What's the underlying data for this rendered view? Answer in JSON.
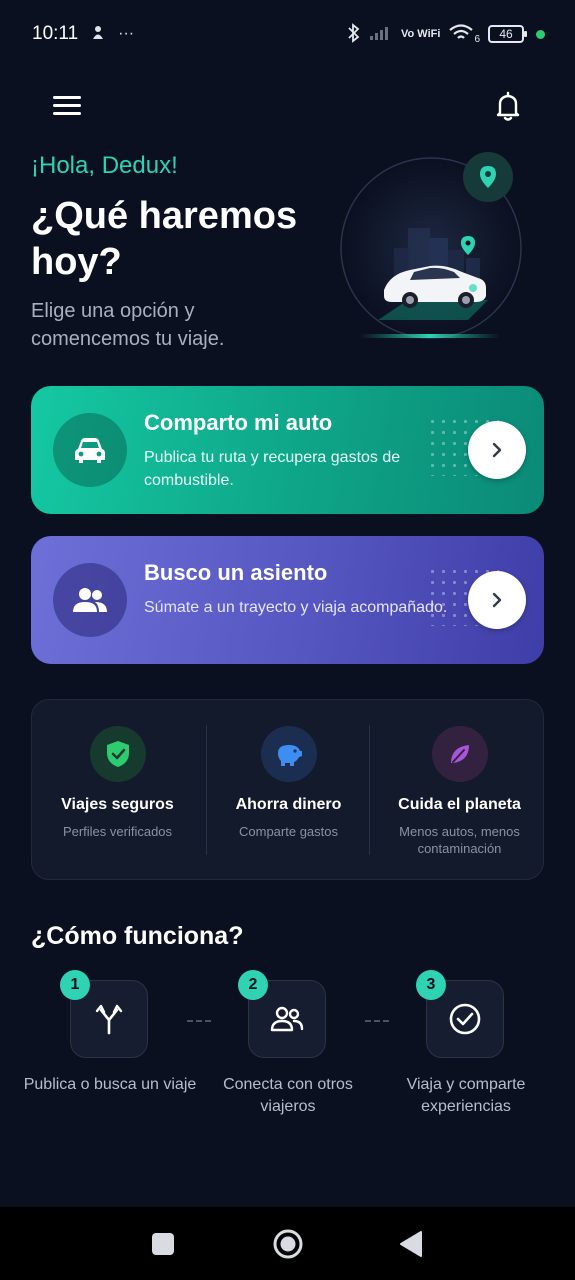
{
  "status_bar": {
    "time": "10:11",
    "misc": "···",
    "network_label": "Vo WiFi",
    "wifi_sub": "6",
    "battery": "46"
  },
  "greeting": "¡Hola, Dedux!",
  "headline": "¿Qué haremos hoy?",
  "subtext": "Elige una opción y comencemos tu viaje.",
  "cards": [
    {
      "title": "Comparto mi auto",
      "description": "Publica tu ruta y recupera gastos de combustible."
    },
    {
      "title": "Busco un asiento",
      "description": "Súmate a un trayecto y viaja acompañado."
    }
  ],
  "benefits": [
    {
      "title": "Viajes seguros",
      "subtitle": "Perfiles verificados"
    },
    {
      "title": "Ahorra dinero",
      "subtitle": "Comparte gastos"
    },
    {
      "title": "Cuida el planeta",
      "subtitle": "Menos autos, menos contaminación"
    }
  ],
  "how_it_works": {
    "title": "¿Cómo funciona?",
    "steps": [
      {
        "number": "1",
        "label": "Publica o busca un viaje"
      },
      {
        "number": "2",
        "label": "Conecta con otros viajeros"
      },
      {
        "number": "3",
        "label": "Viaja y comparte experiencias"
      }
    ]
  },
  "colors": {
    "background": "#0b1020",
    "accent": "#2fd3b3",
    "card_share": "#12b896",
    "card_seat": "#5a5ac4"
  }
}
